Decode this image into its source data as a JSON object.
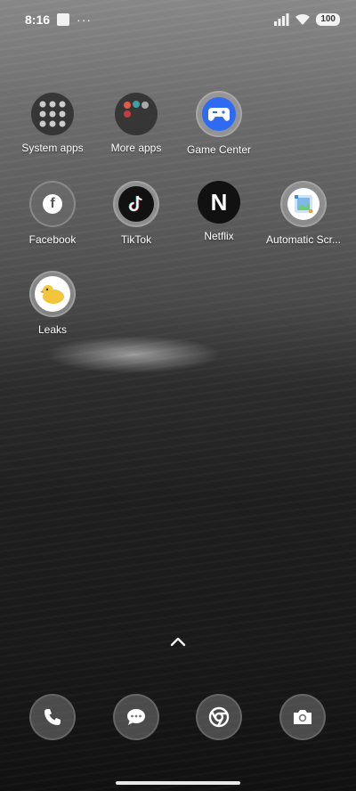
{
  "status_bar": {
    "time": "8:16",
    "more": "···",
    "battery": "100"
  },
  "apps": [
    {
      "label": "System apps",
      "icon": "folder-icon"
    },
    {
      "label": "More apps",
      "icon": "folder-icon"
    },
    {
      "label": "Game Center",
      "icon": "gamepad-icon"
    },
    {
      "label": "Facebook",
      "icon": "facebook-icon"
    },
    {
      "label": "TikTok",
      "icon": "tiktok-icon"
    },
    {
      "label": "Netflix",
      "icon": "netflix-icon"
    },
    {
      "label": "Automatic Scr...",
      "icon": "gallery-icon"
    },
    {
      "label": "Leaks",
      "icon": "duck-icon"
    }
  ],
  "dock": [
    {
      "icon": "phone-icon"
    },
    {
      "icon": "messages-icon"
    },
    {
      "icon": "chrome-icon"
    },
    {
      "icon": "camera-icon"
    }
  ],
  "colors": {
    "game_center_blue": "#2f6bf2",
    "tiktok_black": "#111111",
    "netflix_white": "#ffffff",
    "leaks_yellow": "#f2c53a"
  }
}
